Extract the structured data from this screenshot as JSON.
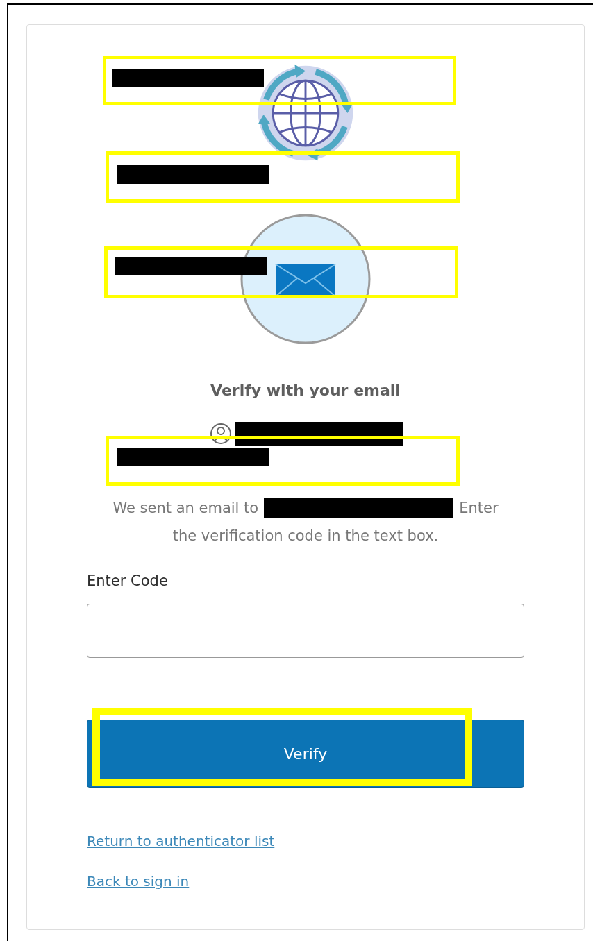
{
  "header": {
    "title": "Verify with your email"
  },
  "message": {
    "before": "We sent an email to",
    "after_lines": [
      "Enter",
      "the verification code in the text box."
    ]
  },
  "code_field": {
    "label": "Enter Code"
  },
  "submit": {
    "label": "Verify"
  },
  "links": [
    "Return to authenticator list",
    "Back to sign in"
  ],
  "overlays": [
    {
      "kind": "highlight"
    },
    {
      "kind": "redaction"
    },
    {
      "kind": "highlight"
    },
    {
      "kind": "redaction"
    },
    {
      "kind": "highlight"
    },
    {
      "kind": "redaction"
    },
    {
      "kind": "redaction"
    },
    {
      "kind": "highlight"
    },
    {
      "kind": "redaction"
    },
    {
      "kind": "highlight"
    }
  ]
}
